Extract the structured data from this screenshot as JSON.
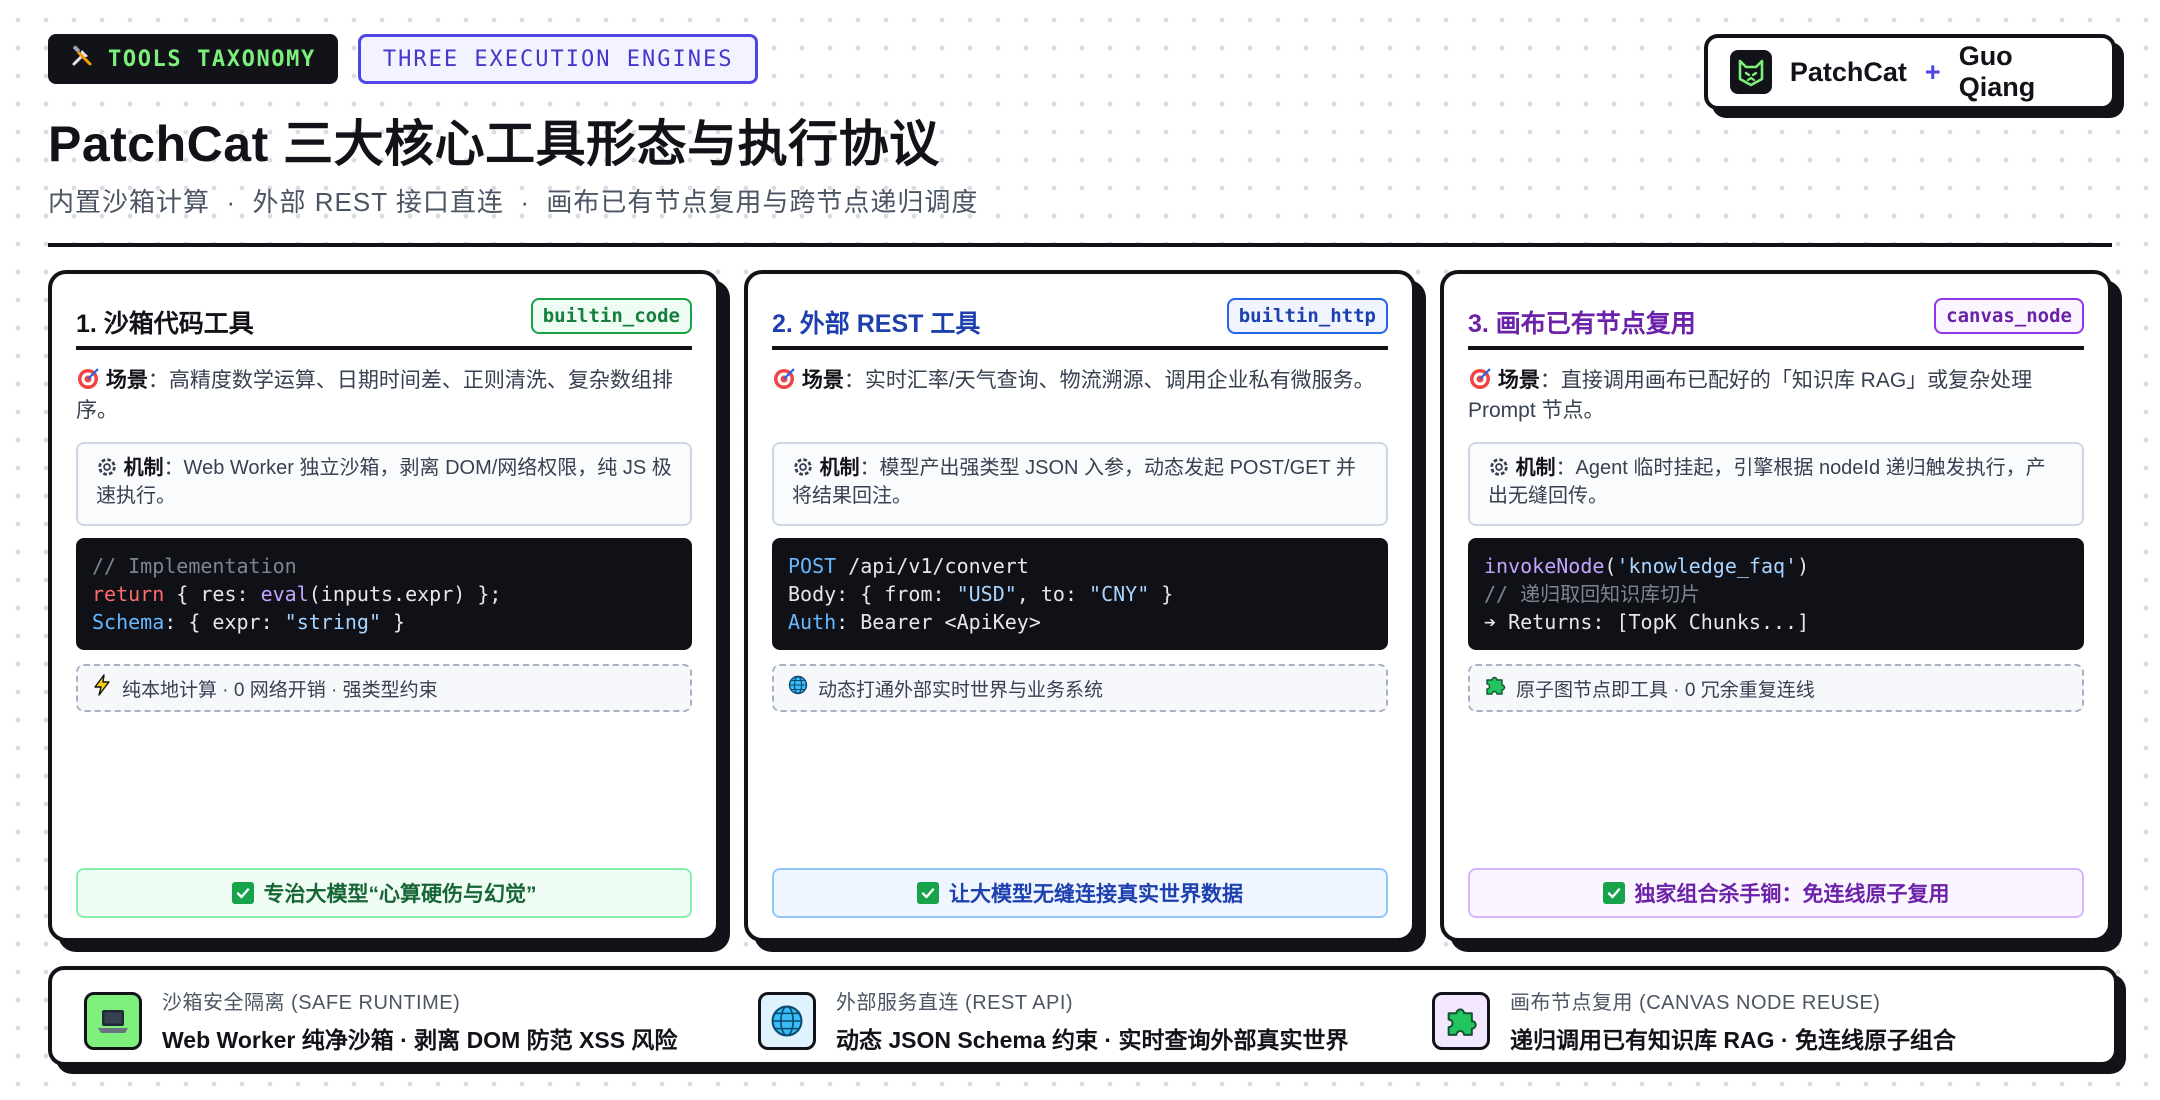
{
  "header": {
    "tag_dark": "TOOLS TAXONOMY",
    "tag_dark_icon": "tools-icon",
    "tag_outline": "THREE EXECUTION ENGINES",
    "brand_name": "PatchCat",
    "brand_plus": "+",
    "brand_author": "Guo Qiang",
    "title": "PatchCat 三大核心工具形态与执行协议",
    "subtitle": "内置沙箱计算  ·  外部 REST 接口直连  ·  画布已有节点复用与跨节点递归调度"
  },
  "colors": {
    "green": "#16a34a",
    "blue": "#1e40af",
    "purple": "#6b21a8",
    "indigo": "#4f46e5",
    "neon": "#7cf07a"
  },
  "cards": [
    {
      "title": "1. 沙箱代码工具",
      "badge": "builtin_code",
      "scene_label": "场景",
      "scene_text": "：高精度数学运算、日期时间差、正则清洗、复杂数组排序。",
      "mech_label": "机制",
      "mech_text": "：Web Worker 独立沙箱，剥离 DOM/网络权限，纯 JS 极速执行。",
      "code": {
        "l1": "// Implementation",
        "l2_kw": "return",
        "l2_a": " { res: ",
        "l2_fn": "eval",
        "l2_b": "(inputs.expr) };",
        "l3_key": "Schema",
        "l3_a": ": { expr: ",
        "l3_str": "\"string\"",
        "l3_b": " }"
      },
      "note": "纯本地计算 · 0 网络开销 · 强类型约束",
      "note_icon": "lightning-icon",
      "verdict": "专治大模型“心算硬伤与幻觉”"
    },
    {
      "title": "2. 外部 REST 工具",
      "badge": "builtin_http",
      "scene_label": "场景",
      "scene_text": "：实时汇率/天气查询、物流溯源、调用企业私有微服务。",
      "mech_label": "机制",
      "mech_text": "：模型产出强类型 JSON 入参，动态发起 POST/GET 并将结果回注。",
      "code": {
        "l1_kw": "POST",
        "l1_a": " /api/v1/convert",
        "l2_a": "Body: { from: ",
        "l2_s1": "\"USD\"",
        "l2_b": ", to: ",
        "l2_s2": "\"CNY\"",
        "l2_c": " }",
        "l3_key": "Auth",
        "l3_a": ": Bearer <ApiKey>"
      },
      "note": "动态打通外部实时世界与业务系统",
      "note_icon": "globe-icon",
      "verdict": "让大模型无缝连接真实世界数据"
    },
    {
      "title": "3. 画布已有节点复用",
      "badge": "canvas_node",
      "scene_label": "场景",
      "scene_text": "：直接调用画布已配好的「知识库 RAG」或复杂处理 Prompt 节点。",
      "mech_label": "机制",
      "mech_text": "：Agent 临时挂起，引擎根据 nodeId 递归触发执行，产出无缝回传。",
      "code": {
        "l1_fn": "invokeNode",
        "l1_a": "(",
        "l1_str": "'knowledge_faq'",
        "l1_b": ")",
        "l2": "// 递归取回知识库切片",
        "l3": "➔ Returns: [TopK Chunks...]"
      },
      "note": "原子图节点即工具 · 0 冗余重复连线",
      "note_icon": "puzzle-icon",
      "verdict": "独家组合杀手锏：免连线原子复用"
    }
  ],
  "footer": [
    {
      "label": "沙箱安全隔离 (SAFE RUNTIME)",
      "text": "Web Worker 纯净沙箱 · 剥离 DOM 防范 XSS 风险",
      "icon": "laptop-icon"
    },
    {
      "label": "外部服务直连 (REST API)",
      "text": "动态 JSON Schema 约束 · 实时查询外部真实世界",
      "icon": "globe-icon"
    },
    {
      "label": "画布节点复用 (CANVAS NODE REUSE)",
      "text": "递归调用已有知识库 RAG · 免连线原子组合",
      "icon": "puzzle-icon"
    }
  ]
}
